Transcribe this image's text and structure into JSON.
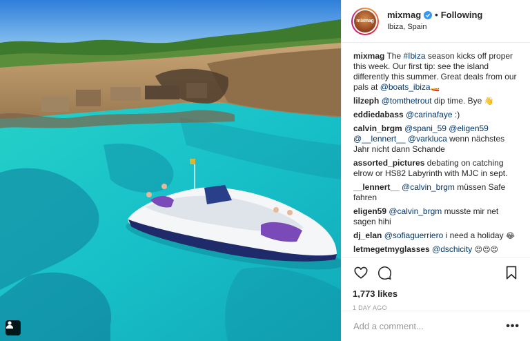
{
  "post": {
    "username": "mixmag",
    "avatar_text": "mixmag",
    "follow_status": "Following",
    "separator": "•",
    "location": "Ibiza, Spain",
    "caption": {
      "user": "mixmag",
      "parts": [
        {
          "t": "text",
          "v": " The "
        },
        {
          "t": "mention",
          "v": "#Ibiza"
        },
        {
          "t": "text",
          "v": " season kicks off proper this week. Our first tip: see the island differently this summer. Great deals from our pals at "
        },
        {
          "t": "mention",
          "v": "@boats_ibiza"
        },
        {
          "t": "emoji",
          "v": "🚤"
        }
      ]
    },
    "comments": [
      {
        "user": "lilzeph",
        "parts": [
          {
            "t": "mention",
            "v": "@tomthetrout"
          },
          {
            "t": "text",
            "v": " dip time. Bye "
          },
          {
            "t": "emoji",
            "v": "👋"
          }
        ]
      },
      {
        "user": "eddiedabass",
        "parts": [
          {
            "t": "mention",
            "v": "@carinafaye"
          },
          {
            "t": "text",
            "v": " :)"
          }
        ]
      },
      {
        "user": "calvin_brgm",
        "parts": [
          {
            "t": "mention",
            "v": "@spani_59"
          },
          {
            "t": "text",
            "v": " "
          },
          {
            "t": "mention",
            "v": "@eligen59"
          },
          {
            "t": "text",
            "v": " "
          },
          {
            "t": "mention",
            "v": "@__lennert__"
          },
          {
            "t": "text",
            "v": " "
          },
          {
            "t": "mention",
            "v": "@varkluca"
          },
          {
            "t": "text",
            "v": " wenn nächstes Jahr nicht dann Schande"
          }
        ]
      },
      {
        "user": "assorted_pictures",
        "parts": [
          {
            "t": "text",
            "v": "debating on catching elrow or HS82 Labyrinth with MJC in sept."
          }
        ]
      },
      {
        "user": "__lennert__",
        "parts": [
          {
            "t": "mention",
            "v": "@calvin_brgm"
          },
          {
            "t": "text",
            "v": " müssen Safe fahren"
          }
        ]
      },
      {
        "user": "eligen59",
        "parts": [
          {
            "t": "mention",
            "v": "@calvin_brgm"
          },
          {
            "t": "text",
            "v": " musste mir net sagen hihi"
          }
        ]
      },
      {
        "user": "dj_elan",
        "parts": [
          {
            "t": "mention",
            "v": "@sofiaguerriero"
          },
          {
            "t": "text",
            "v": " i need a holiday "
          },
          {
            "t": "emoji",
            "v": "😂"
          }
        ]
      },
      {
        "user": "letmegetmyglasses",
        "parts": [
          {
            "t": "mention",
            "v": "@dschicity"
          },
          {
            "t": "text",
            "v": " "
          },
          {
            "t": "emoji",
            "v": "😍😍😍"
          }
        ]
      }
    ],
    "likes": "1,773 likes",
    "timestamp": "1 DAY AGO",
    "add_comment_placeholder": "Add a comment...",
    "more_label": "•••"
  },
  "colors": {
    "mention": "#003569",
    "verified": "#3897f0",
    "border": "#efefef",
    "muted": "#999999",
    "text": "#262626"
  },
  "icons": {
    "like": "heart-icon",
    "comment": "comment-icon",
    "save": "bookmark-icon",
    "tag": "user-tag-icon",
    "verified": "verified-badge-icon"
  }
}
